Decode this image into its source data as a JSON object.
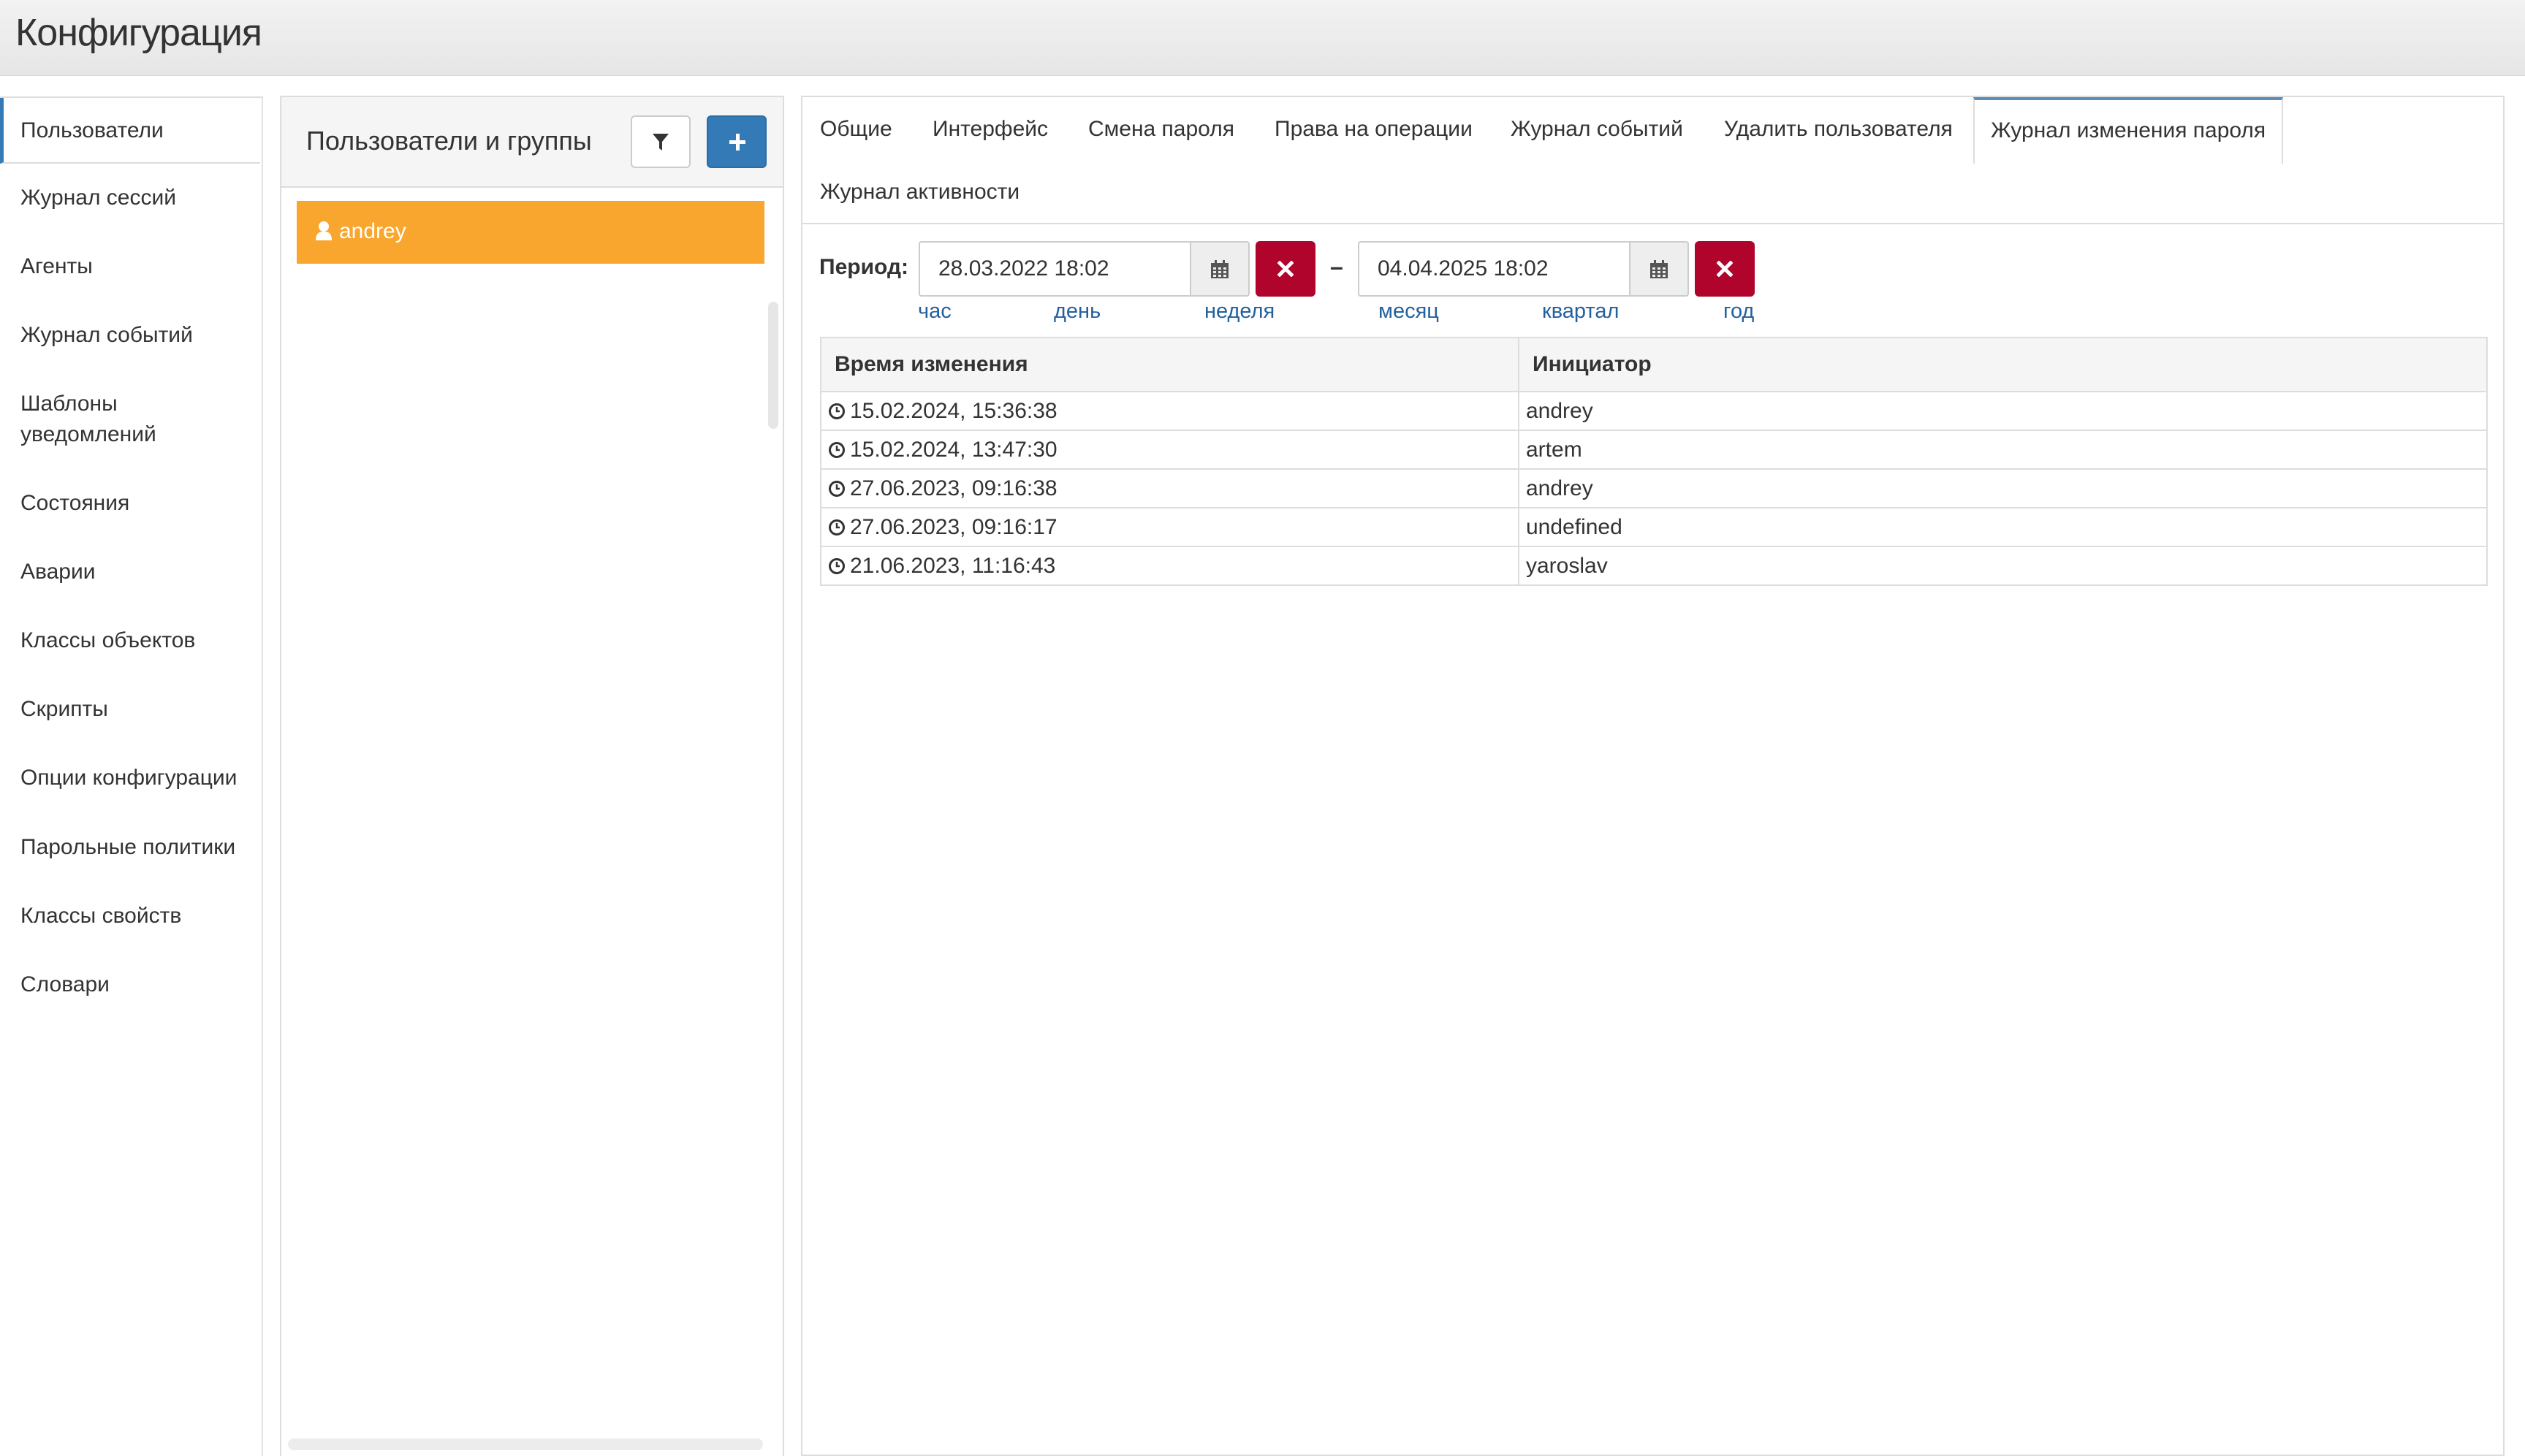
{
  "app": {
    "title": "Конфигурация"
  },
  "sidebar": {
    "items": [
      {
        "label": "Пользователи",
        "active": true
      },
      {
        "label": "Журнал сессий"
      },
      {
        "label": "Агенты"
      },
      {
        "label": "Журнал событий"
      },
      {
        "label": "Шаблоны уведомлений"
      },
      {
        "label": "Состояния"
      },
      {
        "label": "Аварии"
      },
      {
        "label": "Классы объектов"
      },
      {
        "label": "Скрипты"
      },
      {
        "label": "Опции конфигурации"
      },
      {
        "label": "Парольные политики"
      },
      {
        "label": "Классы свойств"
      },
      {
        "label": "Словари"
      }
    ]
  },
  "users_panel": {
    "title": "Пользователи и группы",
    "filter_icon": "filter-icon",
    "add_icon": "plus-icon",
    "users": [
      {
        "name": "andrey",
        "icon": "user-icon",
        "selected": true
      }
    ]
  },
  "tabs": [
    {
      "label": "Общие"
    },
    {
      "label": "Интерфейс"
    },
    {
      "label": "Смена пароля"
    },
    {
      "label": "Права на операции"
    },
    {
      "label": "Журнал событий"
    },
    {
      "label": "Удалить пользователя"
    },
    {
      "label": "Журнал изменения пароля",
      "active": true
    },
    {
      "label": "Журнал активности"
    }
  ],
  "period": {
    "label": "Период:",
    "from": "28.03.2022 18:02",
    "to": "04.04.2025 18:02",
    "separator": "–",
    "quick_ranges": [
      "час",
      "день",
      "неделя",
      "месяц",
      "квартал",
      "год"
    ]
  },
  "table": {
    "columns": [
      "Время изменения",
      "Инициатор"
    ],
    "rows": [
      {
        "time": "15.02.2024, 15:36:38",
        "initiator": "andrey"
      },
      {
        "time": "15.02.2024, 13:47:30",
        "initiator": "artem"
      },
      {
        "time": "27.06.2023, 09:16:38",
        "initiator": "andrey"
      },
      {
        "time": "27.06.2023, 09:16:17",
        "initiator": "undefined"
      },
      {
        "time": "21.06.2023, 11:16:43",
        "initiator": "yaroslav"
      }
    ]
  },
  "colors": {
    "accent": "#337ab7",
    "selected_user": "#f9a62e",
    "clear_button": "#b0042c",
    "link": "#23619e"
  }
}
